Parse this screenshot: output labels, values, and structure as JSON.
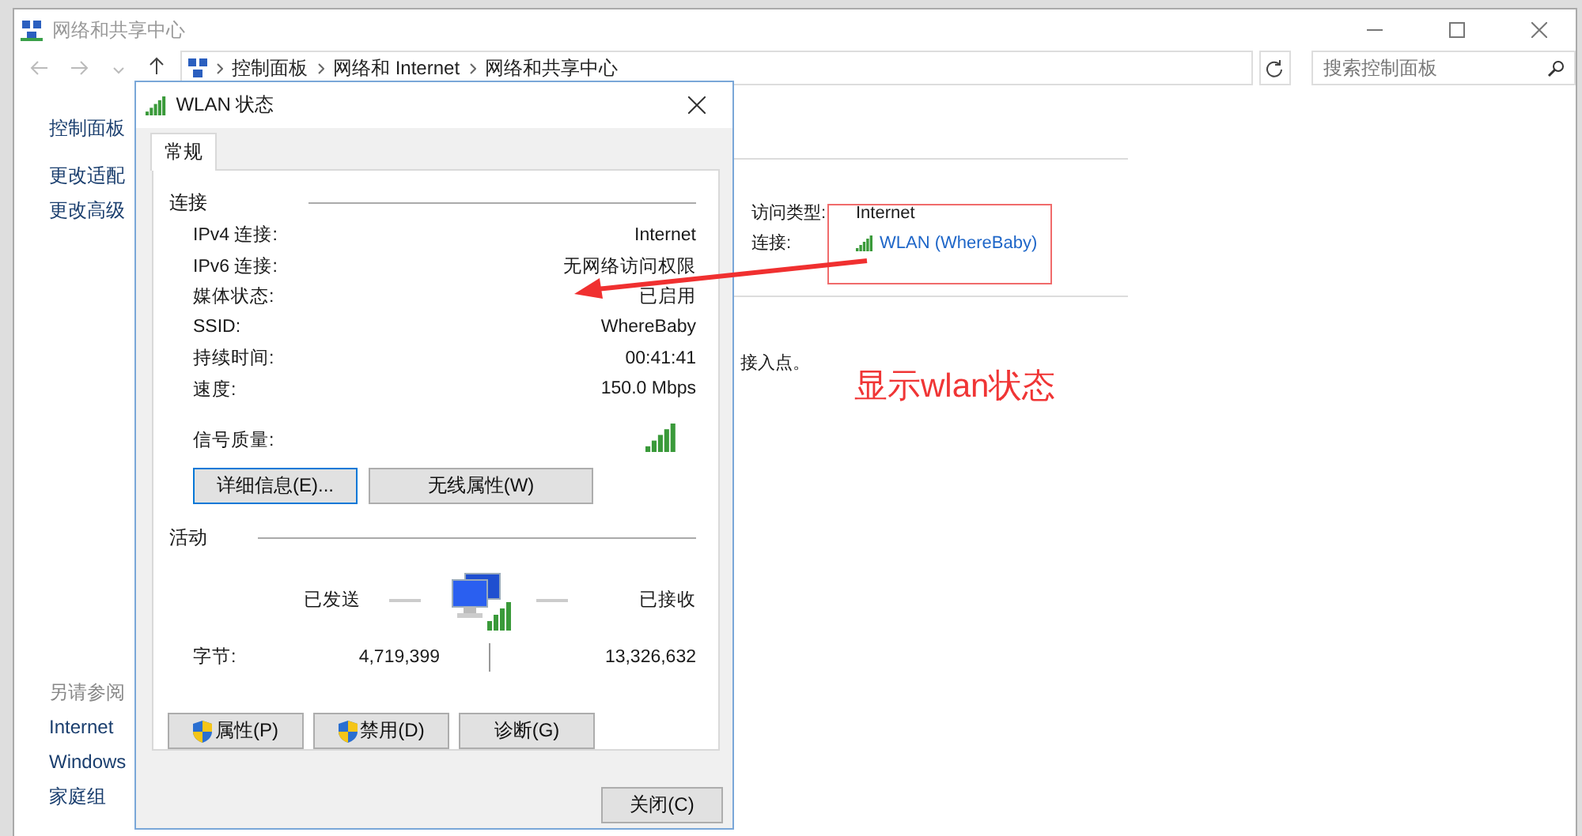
{
  "window": {
    "title": "网络和共享中心",
    "breadcrumb": [
      "控制面板",
      "网络和 Internet",
      "网络和共享中心"
    ],
    "search": {
      "placeholder": "搜索控制面板"
    }
  },
  "sidebar": {
    "items": [
      "控制面板",
      "更改适配",
      "更改高级"
    ],
    "see_also_title": "另请参阅",
    "see_also": [
      "Internet",
      "Windows",
      "家庭组"
    ]
  },
  "network": {
    "access_label": "访问类型:",
    "access_value": "Internet",
    "connection_label": "连接:",
    "connection_link": "WLAN (WhereBaby)",
    "partial_text": "接入点。"
  },
  "dialog": {
    "title": "WLAN 状态",
    "tabs": [
      {
        "label": "常规",
        "selected": true
      }
    ],
    "connection": {
      "heading": "连接",
      "rows": [
        {
          "label": "IPv4 连接:",
          "value": "Internet"
        },
        {
          "label": "IPv6 连接:",
          "value": "无网络访问权限"
        },
        {
          "label": "媒体状态:",
          "value": "已启用"
        },
        {
          "label": "SSID:",
          "value": "WhereBaby"
        },
        {
          "label": "持续时间:",
          "value": "00:41:41"
        },
        {
          "label": "速度:",
          "value": "150.0 Mbps"
        }
      ],
      "signal_label": "信号质量:"
    },
    "buttons": [
      {
        "label": "详细信息(E)...",
        "focused": true
      },
      {
        "label": "无线属性(W)",
        "focused": false
      }
    ],
    "activity": {
      "heading": "活动",
      "sent_label": "已发送",
      "received_label": "已接收",
      "bytes_label": "字节:",
      "sent": "4,719,399",
      "received": "13,326,632"
    },
    "actions": [
      {
        "label": "属性(P)",
        "shield": true
      },
      {
        "label": "禁用(D)",
        "shield": true
      },
      {
        "label": "诊断(G)",
        "shield": false
      }
    ],
    "close": "关闭(C)"
  },
  "annotation": {
    "caption": "显示wlan状态"
  }
}
